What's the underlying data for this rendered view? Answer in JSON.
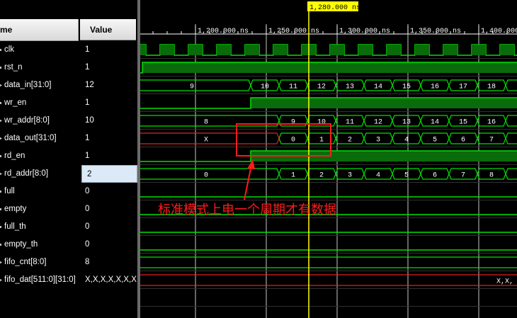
{
  "header": {
    "name_col": "me",
    "value_col": "Value"
  },
  "cursor_label": "1,280.000 ns",
  "timeline": {
    "ticks": [
      {
        "time": 1200,
        "label": "1,200.000 ns"
      },
      {
        "time": 1250,
        "label": "1,250.000 ns"
      },
      {
        "time": 1300,
        "label": "1,300.000 ns"
      },
      {
        "time": 1350,
        "label": "1,350.000 ns"
      },
      {
        "time": 1400,
        "label": "1,400.000"
      }
    ],
    "cursor_time": 1280
  },
  "signals": [
    {
      "name": "clk",
      "value": "1"
    },
    {
      "name": "rst_n",
      "value": "1"
    },
    {
      "name": "data_in[31:0]",
      "value": "12"
    },
    {
      "name": "wr_en",
      "value": "1"
    },
    {
      "name": "wr_addr[8:0]",
      "value": "10"
    },
    {
      "name": "data_out[31:0]",
      "value": "1"
    },
    {
      "name": "rd_en",
      "value": "1"
    },
    {
      "name": "rd_addr[8:0]",
      "value": "2"
    },
    {
      "name": "full",
      "value": "0"
    },
    {
      "name": "empty",
      "value": "0"
    },
    {
      "name": "full_th",
      "value": "0"
    },
    {
      "name": "empty_th",
      "value": "0"
    },
    {
      "name": "fifo_cnt[8:0]",
      "value": "8"
    },
    {
      "name": "fifo_dat[511:0][31:0]",
      "value": "X,X,X,X,X,X,X"
    }
  ],
  "buses": {
    "data_in": [
      "9",
      "10",
      "11",
      "12",
      "13",
      "14",
      "15",
      "16",
      "17",
      "18"
    ],
    "wr_addr": [
      "8",
      "9",
      "10",
      "11",
      "12",
      "13",
      "14",
      "15",
      "16"
    ],
    "data_out": [
      "X",
      "0",
      "1",
      "2",
      "3",
      "4",
      "5",
      "6",
      "7"
    ],
    "rd_addr": [
      "0",
      "1",
      "2",
      "3",
      "4",
      "5",
      "6",
      "7",
      "8"
    ],
    "fifo_dat_tail": "X,X,"
  },
  "annotation": "标准模式上电一个周期才有数据",
  "colors": {
    "wave": "#00e000",
    "fill": "#0a6b0a",
    "x_line": "#e02020",
    "cursor": "#ffff00",
    "annot": "#ff1a1a"
  }
}
